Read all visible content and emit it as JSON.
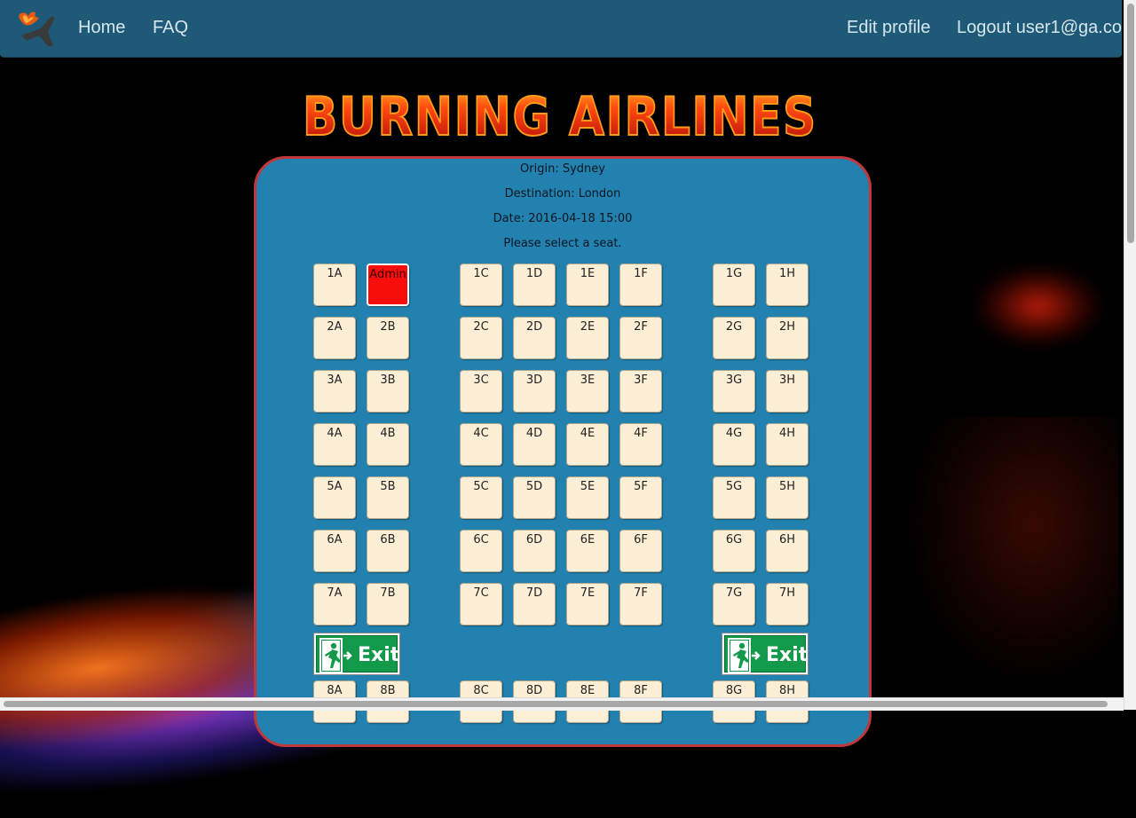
{
  "nav": {
    "home": "Home",
    "faq": "FAQ",
    "edit_profile": "Edit profile",
    "logout": "Logout user1@ga.co"
  },
  "logo_text": "BURNING AIRLINES",
  "flight": {
    "origin": "Origin: Sydney",
    "destination": "Destination: London",
    "date": "Date: 2016-04-18 15:00",
    "prompt": "Please select a seat."
  },
  "seats": {
    "r1": [
      "1A",
      "Admin",
      "1C",
      "1D",
      "1E",
      "1F",
      "1G",
      "1H"
    ],
    "r2": [
      "2A",
      "2B",
      "2C",
      "2D",
      "2E",
      "2F",
      "2G",
      "2H"
    ],
    "r3": [
      "3A",
      "3B",
      "3C",
      "3D",
      "3E",
      "3F",
      "3G",
      "3H"
    ],
    "r4": [
      "4A",
      "4B",
      "4C",
      "4D",
      "4E",
      "4F",
      "4G",
      "4H"
    ],
    "r5": [
      "5A",
      "5B",
      "5C",
      "5D",
      "5E",
      "5F",
      "5G",
      "5H"
    ],
    "r6": [
      "6A",
      "6B",
      "6C",
      "6D",
      "6E",
      "6F",
      "6G",
      "6H"
    ],
    "r7": [
      "7A",
      "7B",
      "7C",
      "7D",
      "7E",
      "7F",
      "7G",
      "7H"
    ],
    "r8": [
      "8A",
      "8B",
      "8C",
      "8D",
      "8E",
      "8F",
      "8G",
      "8H"
    ]
  },
  "taken_seat": "Admin",
  "exit_label": "Exit",
  "colors": {
    "navbar": "#1e5a78",
    "panel": "#2381b0",
    "panel_border": "#c0383c",
    "seat": "#fcefd6",
    "taken": "#f80d0d",
    "exit": "#13994a"
  },
  "icons": {
    "brand": "burning-plane-icon",
    "exit": "running-man-exit-icon"
  }
}
